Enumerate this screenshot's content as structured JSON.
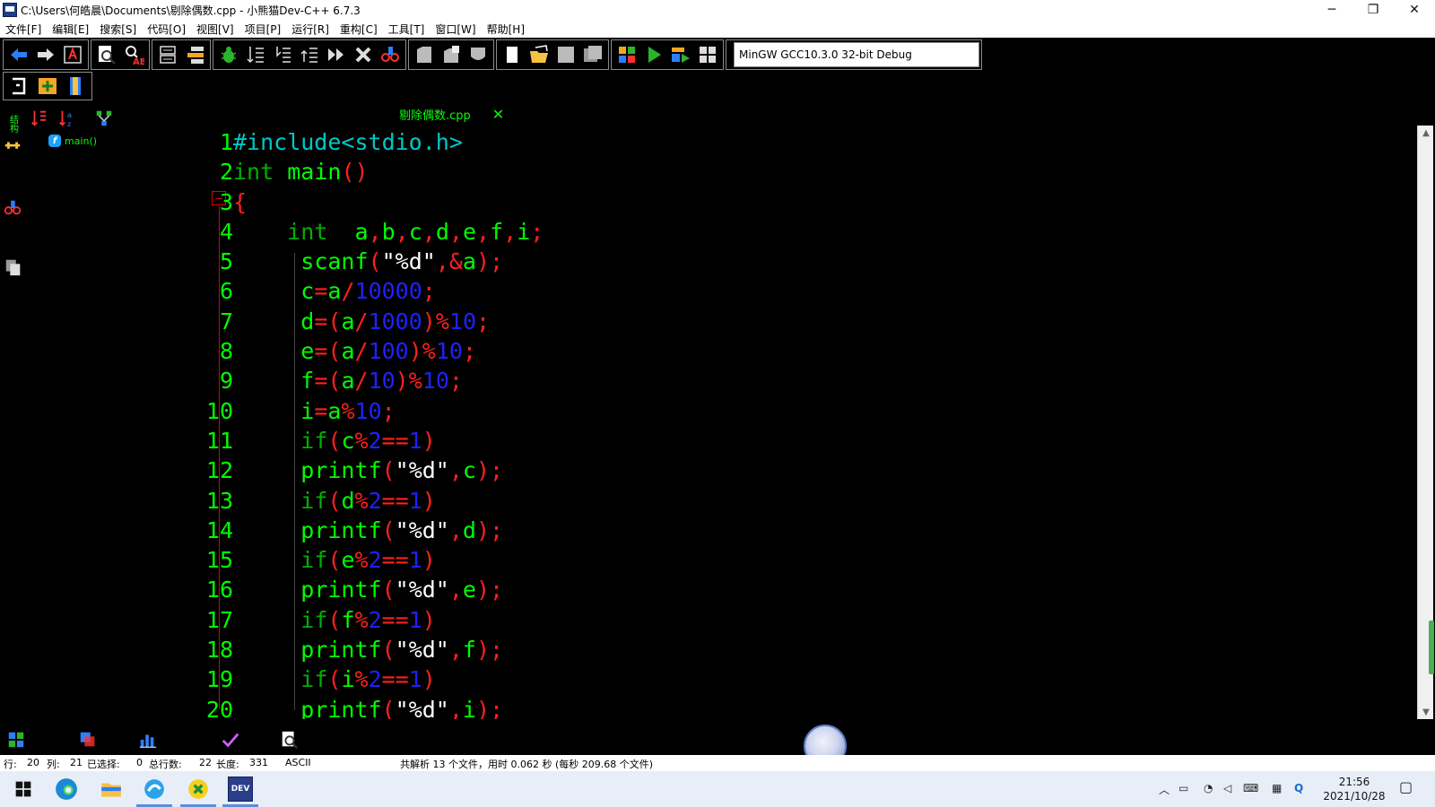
{
  "window": {
    "title": "C:\\Users\\何皓晨\\Documents\\剔除偶数.cpp - 小熊猫Dev-C++ 6.7.3",
    "minimize": "─",
    "maximize": "❐",
    "close": "✕"
  },
  "menu": [
    "文件[F]",
    "编辑[E]",
    "搜索[S]",
    "代码[O]",
    "视图[V]",
    "项目[P]",
    "运行[R]",
    "重构[C]",
    "工具[T]",
    "窗口[W]",
    "帮助[H]"
  ],
  "toolbar": {
    "compiler": "MinGW GCC10.3.0 32-bit Debug"
  },
  "side_panel": {
    "tab_label": "结构",
    "tree_item": "main()",
    "tree_badge": "f"
  },
  "editor": {
    "file_tab": "剔除偶数.cpp",
    "file_tab_close": "✕",
    "lines": [
      {
        "n": "1",
        "t": [
          [
            "pp",
            "#include<stdio.h>"
          ]
        ]
      },
      {
        "n": "2",
        "t": [
          [
            "k",
            "int"
          ],
          [
            "s",
            " "
          ],
          [
            "i",
            "main"
          ],
          [
            "p",
            "()"
          ]
        ]
      },
      {
        "n": "3",
        "t": [
          [
            "p",
            "{"
          ]
        ]
      },
      {
        "n": "4",
        "t": [
          [
            "s",
            "    "
          ],
          [
            "k",
            "int"
          ],
          [
            "s",
            "  "
          ],
          [
            "i",
            "a"
          ],
          [
            "p",
            ","
          ],
          [
            "i",
            "b"
          ],
          [
            "p",
            ","
          ],
          [
            "i",
            "c"
          ],
          [
            "p",
            ","
          ],
          [
            "i",
            "d"
          ],
          [
            "p",
            ","
          ],
          [
            "i",
            "e"
          ],
          [
            "p",
            ","
          ],
          [
            "i",
            "f"
          ],
          [
            "p",
            ","
          ],
          [
            "i",
            "i"
          ],
          [
            "p",
            ";"
          ]
        ]
      },
      {
        "n": "5",
        "t": [
          [
            "s",
            "     "
          ],
          [
            "i",
            "scanf"
          ],
          [
            "p",
            "("
          ],
          [
            "s",
            "\"%d\""
          ],
          [
            "p",
            ",&"
          ],
          [
            "i",
            "a"
          ],
          [
            "p",
            ");"
          ]
        ]
      },
      {
        "n": "6",
        "t": [
          [
            "s",
            "     "
          ],
          [
            "i",
            "c"
          ],
          [
            "p",
            "="
          ],
          [
            "i",
            "a"
          ],
          [
            "p",
            "/"
          ],
          [
            "n",
            "10000"
          ],
          [
            "p",
            ";"
          ]
        ]
      },
      {
        "n": "7",
        "t": [
          [
            "s",
            "     "
          ],
          [
            "i",
            "d"
          ],
          [
            "p",
            "=("
          ],
          [
            "i",
            "a"
          ],
          [
            "p",
            "/"
          ],
          [
            "n",
            "1000"
          ],
          [
            "p",
            ")%"
          ],
          [
            "n",
            "10"
          ],
          [
            "p",
            ";"
          ]
        ]
      },
      {
        "n": "8",
        "t": [
          [
            "s",
            "     "
          ],
          [
            "i",
            "e"
          ],
          [
            "p",
            "=("
          ],
          [
            "i",
            "a"
          ],
          [
            "p",
            "/"
          ],
          [
            "n",
            "100"
          ],
          [
            "p",
            ")%"
          ],
          [
            "n",
            "10"
          ],
          [
            "p",
            ";"
          ]
        ]
      },
      {
        "n": "9",
        "t": [
          [
            "s",
            "     "
          ],
          [
            "i",
            "f"
          ],
          [
            "p",
            "=("
          ],
          [
            "i",
            "a"
          ],
          [
            "p",
            "/"
          ],
          [
            "n",
            "10"
          ],
          [
            "p",
            ")%"
          ],
          [
            "n",
            "10"
          ],
          [
            "p",
            ";"
          ]
        ]
      },
      {
        "n": "10",
        "t": [
          [
            "s",
            "     "
          ],
          [
            "i",
            "i"
          ],
          [
            "p",
            "="
          ],
          [
            "i",
            "a"
          ],
          [
            "p",
            "%"
          ],
          [
            "n",
            "10"
          ],
          [
            "p",
            ";"
          ]
        ]
      },
      {
        "n": "11",
        "t": [
          [
            "s",
            "     "
          ],
          [
            "k",
            "if"
          ],
          [
            "p",
            "("
          ],
          [
            "i",
            "c"
          ],
          [
            "p",
            "%"
          ],
          [
            "n",
            "2"
          ],
          [
            "p",
            "=="
          ],
          [
            "n",
            "1"
          ],
          [
            "p",
            ")"
          ]
        ]
      },
      {
        "n": "12",
        "t": [
          [
            "s",
            "     "
          ],
          [
            "i",
            "printf"
          ],
          [
            "p",
            "("
          ],
          [
            "s",
            "\"%d\""
          ],
          [
            "p",
            ","
          ],
          [
            "i",
            "c"
          ],
          [
            "p",
            ");"
          ]
        ]
      },
      {
        "n": "13",
        "t": [
          [
            "s",
            "     "
          ],
          [
            "k",
            "if"
          ],
          [
            "p",
            "("
          ],
          [
            "i",
            "d"
          ],
          [
            "p",
            "%"
          ],
          [
            "n",
            "2"
          ],
          [
            "p",
            "=="
          ],
          [
            "n",
            "1"
          ],
          [
            "p",
            ")"
          ]
        ]
      },
      {
        "n": "14",
        "t": [
          [
            "s",
            "     "
          ],
          [
            "i",
            "printf"
          ],
          [
            "p",
            "("
          ],
          [
            "s",
            "\"%d\""
          ],
          [
            "p",
            ","
          ],
          [
            "i",
            "d"
          ],
          [
            "p",
            ");"
          ]
        ]
      },
      {
        "n": "15",
        "t": [
          [
            "s",
            "     "
          ],
          [
            "k",
            "if"
          ],
          [
            "p",
            "("
          ],
          [
            "i",
            "e"
          ],
          [
            "p",
            "%"
          ],
          [
            "n",
            "2"
          ],
          [
            "p",
            "=="
          ],
          [
            "n",
            "1"
          ],
          [
            "p",
            ")"
          ]
        ]
      },
      {
        "n": "16",
        "t": [
          [
            "s",
            "     "
          ],
          [
            "i",
            "printf"
          ],
          [
            "p",
            "("
          ],
          [
            "s",
            "\"%d\""
          ],
          [
            "p",
            ","
          ],
          [
            "i",
            "e"
          ],
          [
            "p",
            ");"
          ]
        ]
      },
      {
        "n": "17",
        "t": [
          [
            "s",
            "     "
          ],
          [
            "k",
            "if"
          ],
          [
            "p",
            "("
          ],
          [
            "i",
            "f"
          ],
          [
            "p",
            "%"
          ],
          [
            "n",
            "2"
          ],
          [
            "p",
            "=="
          ],
          [
            "n",
            "1"
          ],
          [
            "p",
            ")"
          ]
        ]
      },
      {
        "n": "18",
        "t": [
          [
            "s",
            "     "
          ],
          [
            "i",
            "printf"
          ],
          [
            "p",
            "("
          ],
          [
            "s",
            "\"%d\""
          ],
          [
            "p",
            ","
          ],
          [
            "i",
            "f"
          ],
          [
            "p",
            ");"
          ]
        ]
      },
      {
        "n": "19",
        "t": [
          [
            "s",
            "     "
          ],
          [
            "k",
            "if"
          ],
          [
            "p",
            "("
          ],
          [
            "i",
            "i"
          ],
          [
            "p",
            "%"
          ],
          [
            "n",
            "2"
          ],
          [
            "p",
            "=="
          ],
          [
            "n",
            "1"
          ],
          [
            "p",
            ")"
          ]
        ]
      },
      {
        "n": "20",
        "t": [
          [
            "s",
            "     "
          ],
          [
            "i",
            "printf"
          ],
          [
            "p",
            "("
          ],
          [
            "s",
            "\"%d\""
          ],
          [
            "p",
            ","
          ],
          [
            "i",
            "i"
          ],
          [
            "p",
            ");"
          ]
        ]
      }
    ]
  },
  "status": {
    "line_label": "行:",
    "line": "20",
    "col_label": "列:",
    "col": "21",
    "sel_label": "已选择:",
    "sel": "0",
    "total_label": "总行数:",
    "total": "22",
    "len_label": "长度:",
    "len": "331",
    "encoding": "ASCII",
    "message": "共解析 13 个文件，用时 0.062 秒 (每秒 209.68 个文件)"
  },
  "taskbar": {
    "time": "21:56",
    "date": "2021/10/28",
    "dev_label": "DEV"
  },
  "colors": {
    "keyword": "#00b000",
    "identifier": "#00ff00",
    "punctuation": "#ff2020",
    "number": "#2020ff",
    "string": "#ffffff",
    "preprocessor": "#00c8c8"
  }
}
